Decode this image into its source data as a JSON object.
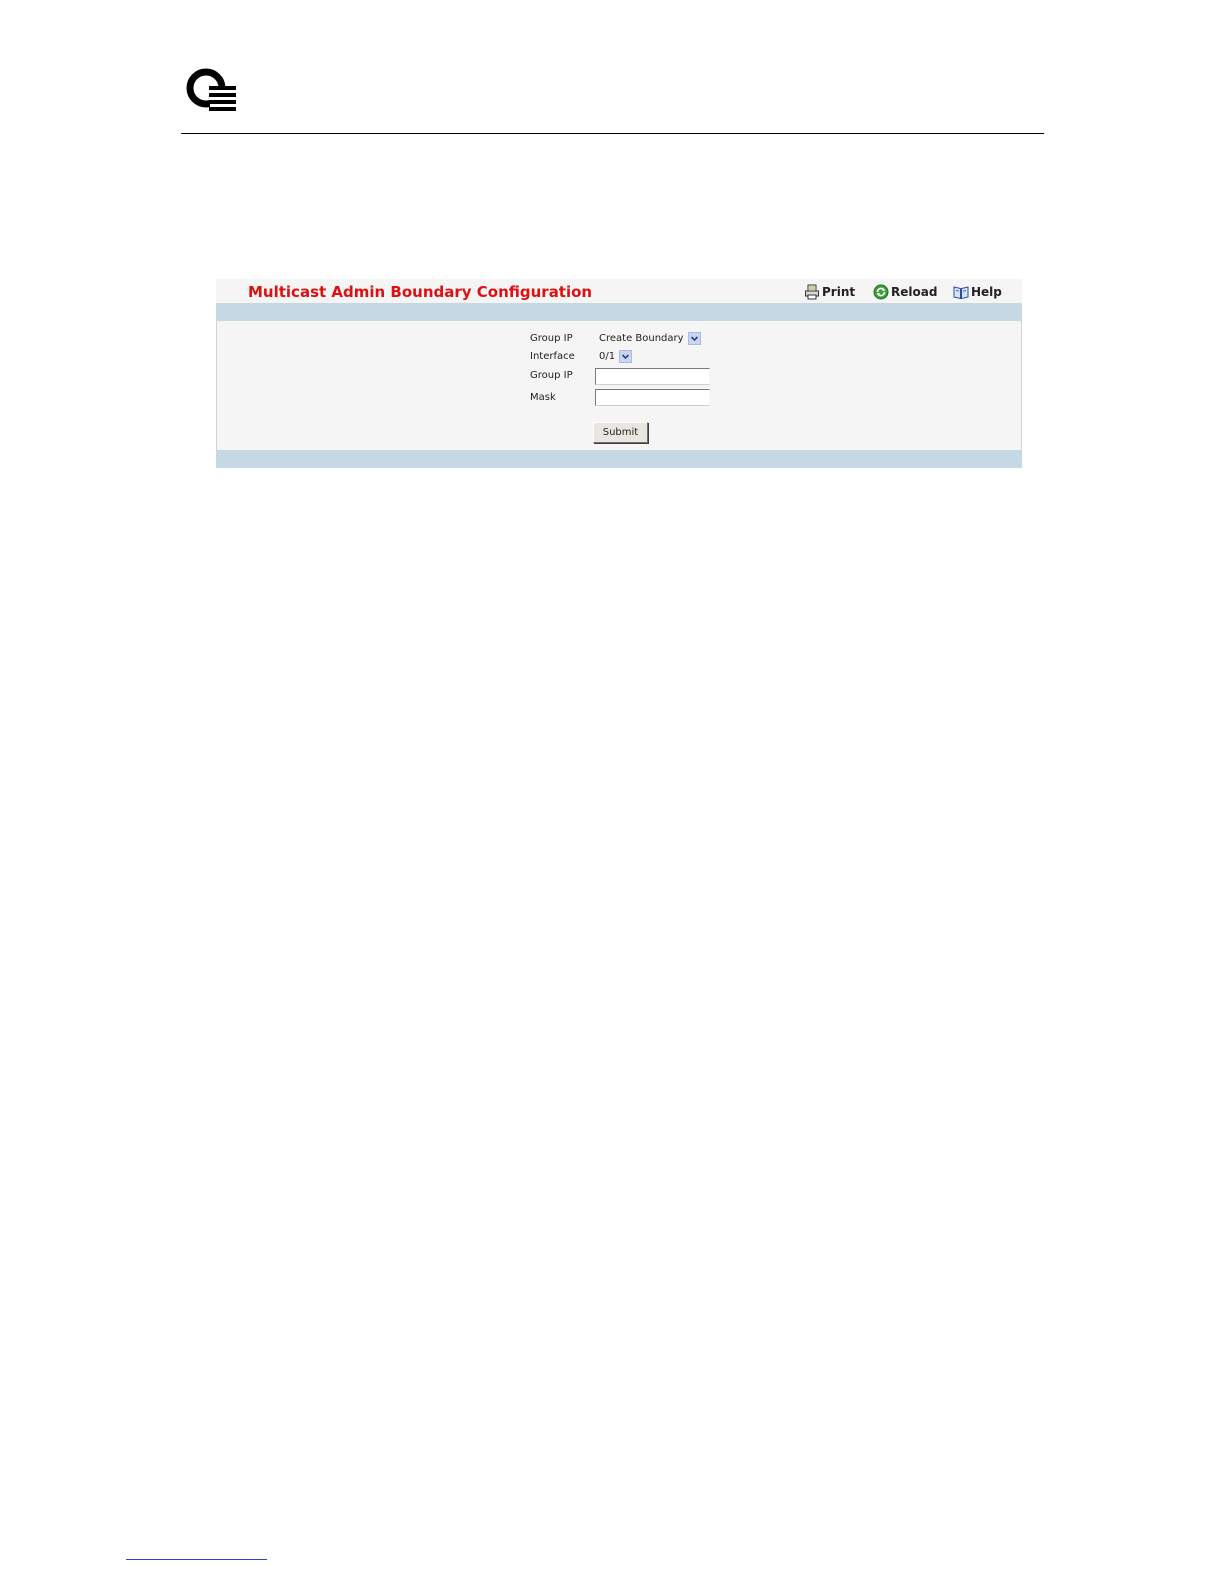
{
  "document": {
    "logo_icon": "q-stack-logo-icon"
  },
  "panel": {
    "title": "Multicast Admin Boundary Configuration",
    "toolbar": {
      "print_label": "Print",
      "print_icon": "printer-icon",
      "reload_label": "Reload",
      "reload_icon": "reload-icon",
      "help_label": "Help",
      "help_icon": "book-icon"
    },
    "form": {
      "boundary_select": {
        "label": "Group IP",
        "value": "Create Boundary"
      },
      "interface_select": {
        "label": "Interface",
        "value": "0/1"
      },
      "group_ip_field": {
        "label": "Group IP",
        "value": ""
      },
      "mask_field": {
        "label": "Mask",
        "value": ""
      },
      "submit_label": "Submit"
    }
  },
  "colors": {
    "title": "#dd1111",
    "band": "#c5d9e4",
    "panel_bg": "#f5f5f5",
    "select_button": "#c8d6f0"
  }
}
